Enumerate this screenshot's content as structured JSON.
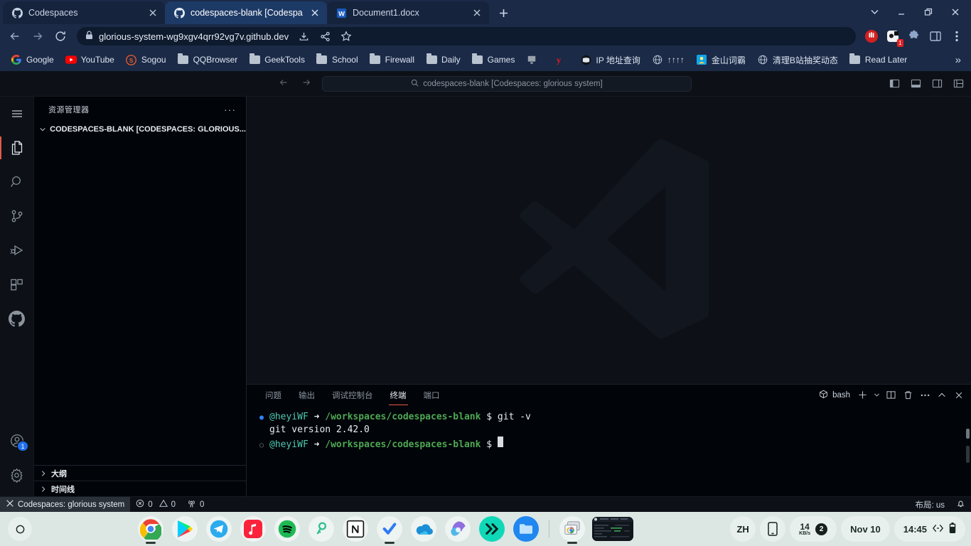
{
  "browser": {
    "tabs": [
      {
        "title": "Codespaces",
        "favicon": "github-icon",
        "active": false
      },
      {
        "title": "codespaces-blank [Codespaces",
        "favicon": "github-icon",
        "active": true
      },
      {
        "title": "Document1.docx",
        "favicon": "word-icon",
        "active": false
      }
    ],
    "new_tab_label": "+",
    "window_controls": [
      "chevron-down-icon",
      "minimize-icon",
      "restore-icon",
      "close-icon"
    ],
    "nav": {
      "back": "back-arrow-icon",
      "forward": "forward-arrow-icon",
      "reload": "reload-icon"
    },
    "omnibox": {
      "value": "glorious-system-wg9xgv4qrr92vg7v.github.dev",
      "lock": "lock-icon"
    },
    "omnibox_actions": [
      "download-icon",
      "share-icon",
      "bookmark-star-icon"
    ],
    "toolbar_icons": [
      "adblock-icon",
      "extension-badge-icon",
      "puzzle-icon",
      "side-panel-icon",
      "more-vert-icon"
    ],
    "extension_badge_count": "1",
    "bookmarks": [
      {
        "label": "Google",
        "icon": "google-icon"
      },
      {
        "label": "YouTube",
        "icon": "youtube-icon"
      },
      {
        "label": "Sogou",
        "icon": "sogou-icon"
      },
      {
        "label": "QQBrowser",
        "icon": "folder-icon"
      },
      {
        "label": "GeekTools",
        "icon": "folder-icon"
      },
      {
        "label": "School",
        "icon": "folder-icon"
      },
      {
        "label": "Firewall",
        "icon": "folder-icon"
      },
      {
        "label": "Daily",
        "icon": "folder-icon"
      },
      {
        "label": "Games",
        "icon": "folder-icon"
      },
      {
        "label": "",
        "icon": "keyboard-icon"
      },
      {
        "label": "",
        "icon": "yandex-icon"
      },
      {
        "label": "IP 地址查询",
        "icon": "globe-dark-icon"
      },
      {
        "label": "↑↑↑↑",
        "icon": "globe-icon"
      },
      {
        "label": "金山词霸",
        "icon": "kingsoft-icon"
      },
      {
        "label": "清理B站抽奖动态",
        "icon": "globe-icon"
      },
      {
        "label": "Read Later",
        "icon": "folder-icon"
      }
    ],
    "bookmarks_overflow": "»"
  },
  "vscode": {
    "titlebar": {
      "back": "back-arrow-icon",
      "forward": "forward-arrow-icon",
      "command_center": "codespaces-blank [Codespaces: glorious system]",
      "search_icon": "search-icon",
      "layout_icons": [
        "toggle-primary-sidebar-icon",
        "toggle-panel-icon",
        "toggle-secondary-sidebar-icon",
        "customize-layout-icon"
      ]
    },
    "activitybar": [
      {
        "name": "menu-icon",
        "active": false
      },
      {
        "name": "explorer-icon",
        "active": true
      },
      {
        "name": "search-icon",
        "active": false
      },
      {
        "name": "source-control-icon",
        "active": false
      },
      {
        "name": "run-and-debug-icon",
        "active": false
      },
      {
        "name": "extensions-icon",
        "active": false
      },
      {
        "name": "github-icon",
        "active": false
      }
    ],
    "activitybar_bottom": [
      {
        "name": "accounts-icon",
        "badge": "1"
      },
      {
        "name": "settings-gear-icon",
        "badge": ""
      }
    ],
    "sidebar": {
      "title": "资源管理器",
      "more_actions": "···",
      "tree_root": "CODESPACES-BLANK [CODESPACES: GLORIOUS...",
      "bottom_sections": [
        {
          "label": "大纲"
        },
        {
          "label": "时间线"
        }
      ]
    },
    "panel": {
      "tabs": [
        {
          "label": "问题",
          "active": false
        },
        {
          "label": "输出",
          "active": false
        },
        {
          "label": "调试控制台",
          "active": false
        },
        {
          "label": "终端",
          "active": true
        },
        {
          "label": "端口",
          "active": false
        }
      ],
      "shell_label": "bash",
      "actions": [
        "new-terminal-icon",
        "terminal-profile-chevron-icon",
        "split-terminal-icon",
        "kill-terminal-icon",
        "more-actions-icon",
        "maximize-panel-icon",
        "close-panel-icon"
      ]
    },
    "terminal": {
      "lines": [
        {
          "marker": "filled",
          "user": "@heyiWF",
          "arrow": "➜",
          "path": "/workspaces/codespaces-blank",
          "prompt": "$",
          "command": "git -v"
        },
        {
          "marker": "none",
          "output": "git version 2.42.0"
        },
        {
          "marker": "empty",
          "user": "@heyiWF",
          "arrow": "➜",
          "path": "/workspaces/codespaces-blank",
          "prompt": "$",
          "command": ""
        }
      ]
    },
    "statusbar": {
      "remote_icon": "remote-indicator-icon",
      "remote_label": "Codespaces: glorious system",
      "errors_icon": "error-icon",
      "errors": "0",
      "warnings_icon": "warning-icon",
      "warnings": "0",
      "ports_icon": "radio-tower-icon",
      "ports": "0",
      "layout_label": "布局: us",
      "bell_icon": "bell-icon"
    }
  },
  "taskbar": {
    "home_icon": "home-circle-icon",
    "apps": [
      {
        "name": "chrome-icon",
        "running": true
      },
      {
        "name": "google-play-icon",
        "running": false
      },
      {
        "name": "telegram-icon",
        "running": false
      },
      {
        "name": "apple-music-icon",
        "running": false
      },
      {
        "name": "spotify-icon",
        "running": false
      },
      {
        "name": "password-key-icon",
        "running": false
      },
      {
        "name": "notion-icon",
        "running": false
      },
      {
        "name": "todoist-icon",
        "running": true
      },
      {
        "name": "onedrive-icon",
        "running": false
      },
      {
        "name": "microsoft-copilot-icon",
        "running": false
      },
      {
        "name": "fast-forward-icon",
        "running": false
      },
      {
        "name": "files-icon",
        "running": false
      }
    ],
    "recent": [
      {
        "name": "chrome-windows-icon",
        "running": true
      },
      {
        "name": "terminal-preview-icon",
        "running": false
      }
    ],
    "tray": {
      "language": "ZH",
      "phone_icon": "phone-link-icon",
      "net_speed_value": "14",
      "net_speed_unit": "KB/s",
      "net_count": "2",
      "date": "Nov 10",
      "time": "14:45",
      "network_icon": "ethernet-icon",
      "battery_icon": "battery-icon"
    }
  }
}
